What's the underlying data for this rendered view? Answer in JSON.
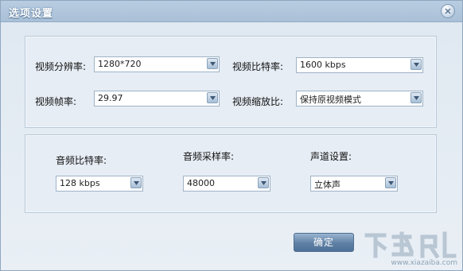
{
  "window": {
    "title": "选项设置"
  },
  "video": {
    "resolution_label": "视频分辨率:",
    "resolution_value": "1280*720",
    "bitrate_label": "视频比特率:",
    "bitrate_value": "1600 kbps",
    "framerate_label": "视频帧率:",
    "framerate_value": "29.97",
    "scale_label": "视频缩放比:",
    "scale_value": "保持原视频模式"
  },
  "audio": {
    "bitrate_label": "音频比特率:",
    "bitrate_value": "128 kbps",
    "samplerate_label": "音频采样率:",
    "samplerate_value": "48000",
    "channel_label": "声道设置:",
    "channel_value": "立体声"
  },
  "buttons": {
    "ok_label": "确定"
  },
  "watermark": {
    "text": "下载吧",
    "url": "www.xiazaiba.com"
  },
  "icons": {
    "close": "close-icon",
    "dropdown": "chevron-down-icon"
  },
  "colors": {
    "titlebar": "#a9c0d7",
    "button": "#5f80a4"
  }
}
